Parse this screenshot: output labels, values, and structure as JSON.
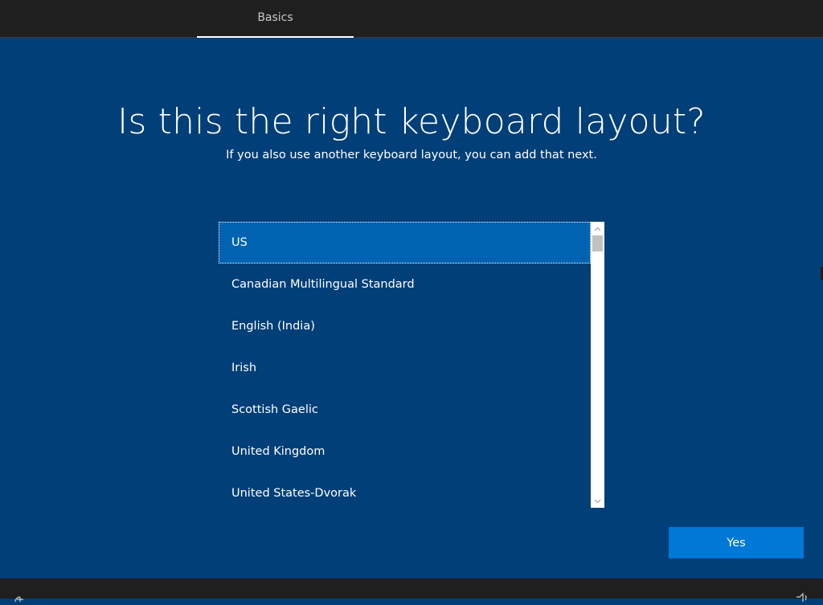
{
  "header": {
    "tab_label": "Basics"
  },
  "page": {
    "title": "Is this the right keyboard layout?",
    "subtitle": "If you also use another keyboard layout, you can add that next."
  },
  "layout_list": {
    "selected_index": 0,
    "items": [
      {
        "label": "US"
      },
      {
        "label": "Canadian Multilingual Standard"
      },
      {
        "label": "English (India)"
      },
      {
        "label": "Irish"
      },
      {
        "label": "Scottish Gaelic"
      },
      {
        "label": "United Kingdom"
      },
      {
        "label": "United States-Dvorak"
      }
    ]
  },
  "actions": {
    "yes_label": "Yes"
  },
  "footer": {
    "left_icon": "ease-of-access-icon",
    "right_icon": "volume-icon"
  },
  "colors": {
    "background": "#003f78",
    "bar": "#1f1f1f",
    "selected_item": "#0063b1",
    "accent_button": "#0078d7"
  }
}
